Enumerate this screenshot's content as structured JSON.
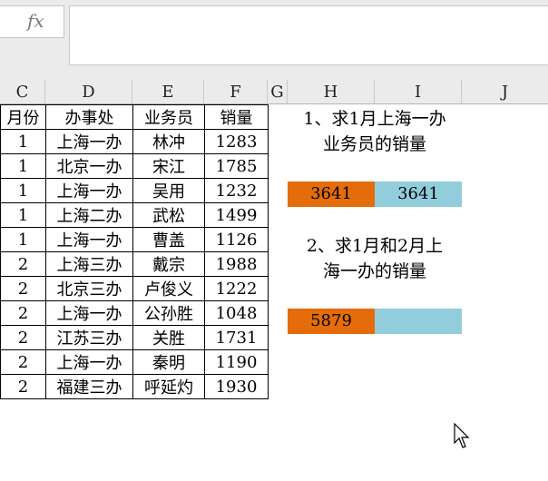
{
  "formula_bar": {
    "fx_label": "fx",
    "content": ""
  },
  "columns": [
    "C",
    "D",
    "E",
    "F",
    "G",
    "H",
    "I",
    "J"
  ],
  "table": {
    "headers": [
      "月份",
      "办事处",
      "业务员",
      "销量"
    ],
    "rows": [
      [
        "1",
        "上海一办",
        "林冲",
        "1283"
      ],
      [
        "1",
        "北京一办",
        "宋江",
        "1785"
      ],
      [
        "1",
        "上海一办",
        "吴用",
        "1232"
      ],
      [
        "1",
        "上海二办",
        "武松",
        "1499"
      ],
      [
        "1",
        "上海一办",
        "曹盖",
        "1126"
      ],
      [
        "2",
        "上海三办",
        "戴宗",
        "1988"
      ],
      [
        "2",
        "北京三办",
        "卢俊义",
        "1222"
      ],
      [
        "2",
        "上海一办",
        "公孙胜",
        "1048"
      ],
      [
        "2",
        "江苏三办",
        "关胜",
        "1731"
      ],
      [
        "2",
        "上海一办",
        "秦明",
        "1190"
      ],
      [
        "2",
        "福建三办",
        "呼延灼",
        "1930"
      ]
    ]
  },
  "question1": {
    "line1": "1、求1月上海一办",
    "line2": "业务员的销量",
    "h_value": "3641",
    "i_value": "3641"
  },
  "question2": {
    "line1": "2、求1月和2月上",
    "line2": "海一办的销量",
    "h_value": "5879",
    "i_value": ""
  },
  "colors": {
    "orange": "#e46c0a",
    "blue": "#92cddc"
  }
}
